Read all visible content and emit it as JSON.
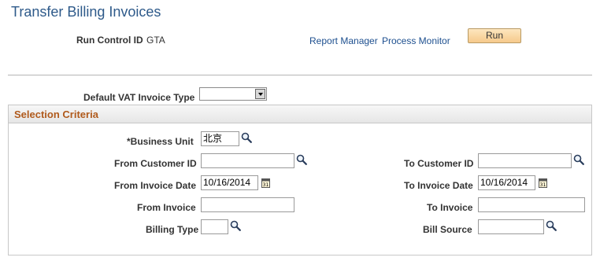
{
  "page": {
    "title": "Transfer Billing Invoices",
    "run_control_label": "Run Control ID",
    "run_control_value": "GTA",
    "report_manager_link": "Report Manager",
    "process_monitor_link": "Process Monitor",
    "run_button": "Run"
  },
  "vat": {
    "label": "Default VAT Invoice Type",
    "selected_value": ""
  },
  "selection": {
    "title": "Selection Criteria",
    "business_unit_label": "*Business Unit",
    "business_unit_value": "北京",
    "from_customer_label": "From Customer ID",
    "from_customer_value": "",
    "to_customer_label": "To Customer ID",
    "to_customer_value": "",
    "from_invoice_date_label": "From Invoice Date",
    "from_invoice_date_value": "10/16/2014",
    "to_invoice_date_label": "To Invoice Date",
    "to_invoice_date_value": "10/16/2014",
    "from_invoice_label": "From Invoice",
    "from_invoice_value": "",
    "to_invoice_label": "To Invoice",
    "to_invoice_value": "",
    "billing_type_label": "Billing Type",
    "billing_type_value": "",
    "bill_source_label": "Bill Source",
    "bill_source_value": ""
  },
  "icons": {
    "lookup": "magnifier-icon",
    "calendar": "calendar-icon",
    "dropdown": "chevron-down-icon"
  },
  "colors": {
    "title": "#2e5a8a",
    "section_title": "#b05a1c",
    "link": "#1d4f8f",
    "button_bg": "#f6c98b"
  }
}
